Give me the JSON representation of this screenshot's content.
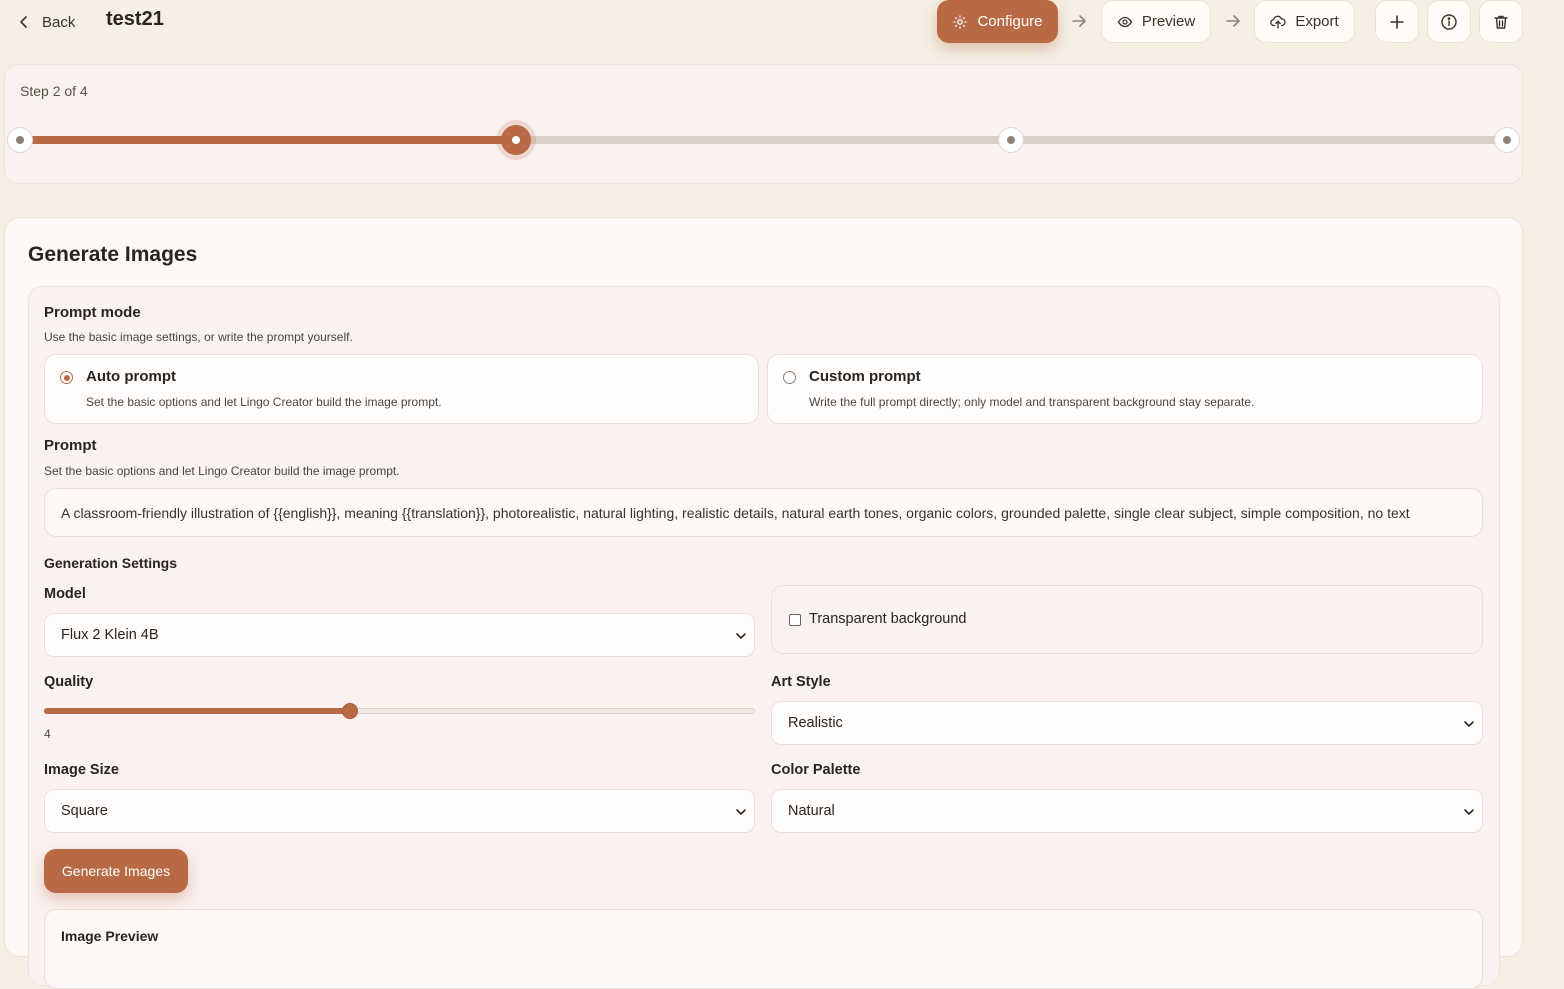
{
  "header": {
    "back_label": "Back",
    "title": "test21",
    "configure_label": "Configure",
    "preview_label": "Preview",
    "export_label": "Export"
  },
  "progress": {
    "step_label": "Step 2 of 4",
    "current_step": 2,
    "total_steps": 4,
    "fraction": 0.333
  },
  "generate": {
    "section_title": "Generate Images",
    "prompt_mode": {
      "label": "Prompt mode",
      "help": "Use the basic image settings, or write the prompt yourself.",
      "options": [
        {
          "title": "Auto prompt",
          "desc": "Set the basic options and let Lingo Creator build the image prompt.",
          "selected": true
        },
        {
          "title": "Custom prompt",
          "desc": "Write the full prompt directly; only model and transparent background stay separate.",
          "selected": false
        }
      ]
    },
    "prompt": {
      "label": "Prompt",
      "help": "Set the basic options and let Lingo Creator build the image prompt.",
      "value": "A classroom-friendly illustration of {{english}}, meaning {{translation}}, photorealistic, natural lighting, realistic details, natural earth tones, organic colors, grounded palette, single clear subject, simple composition, no text"
    },
    "settings": {
      "heading": "Generation Settings",
      "model_label": "Model",
      "model_value": "Flux 2 Klein 4B",
      "transparent_label": "Transparent background",
      "transparent_checked": false,
      "quality_label": "Quality",
      "quality_value": "4",
      "quality_fraction": 0.43,
      "art_style_label": "Art Style",
      "art_style_value": "Realistic",
      "image_size_label": "Image Size",
      "image_size_value": "Square",
      "color_palette_label": "Color Palette",
      "color_palette_value": "Natural"
    },
    "generate_button": "Generate Images",
    "preview_title": "Image Preview"
  },
  "colors": {
    "accent": "#b86a45",
    "background": "#f5efe4",
    "card": "#fbf1f0"
  },
  "icons": [
    "chevron-left-icon",
    "gear-icon",
    "arrow-right-icon",
    "eye-icon",
    "cloud-upload-icon",
    "plus-icon",
    "info-icon",
    "trash-icon",
    "chevron-down-icon"
  ]
}
